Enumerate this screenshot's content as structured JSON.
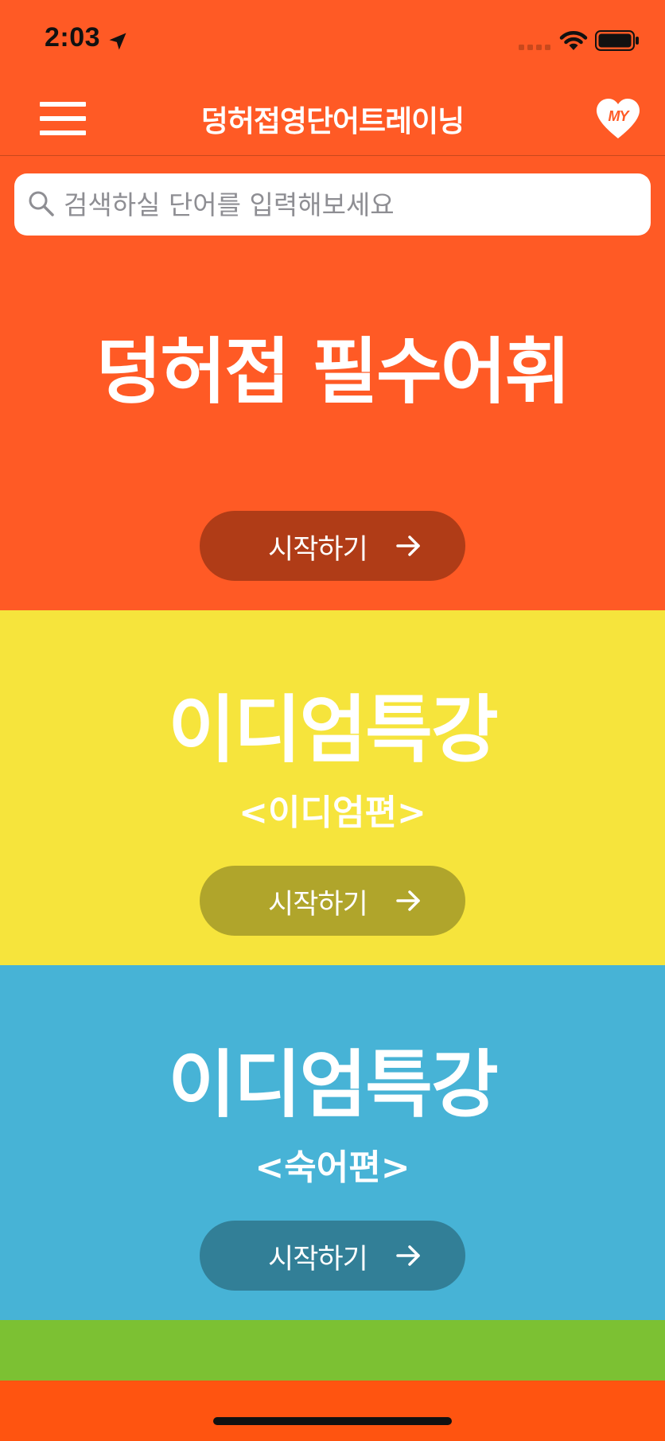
{
  "status_bar": {
    "time": "2:03"
  },
  "nav": {
    "title": "덩허접영단어트레이닝",
    "my_label": "MY"
  },
  "search": {
    "placeholder": "검색하실 단어를 입력해보세요",
    "value": ""
  },
  "cards": [
    {
      "title": "덩허접 필수어휘",
      "subtitle": "",
      "button_label": "시작하기",
      "background": "#FF5A25",
      "button_color": "#B03C17"
    },
    {
      "title": "이디엄특강",
      "subtitle": "<이디엄편>",
      "button_label": "시작하기",
      "background": "#F6E43C",
      "button_color": "#B0A52B"
    },
    {
      "title": "이디엄특강",
      "subtitle": "<숙어편>",
      "button_label": "시작하기",
      "background": "#47B3D6",
      "button_color": "#327F97"
    },
    {
      "title": "",
      "subtitle": "",
      "button_label": "",
      "background": "#7CC133"
    }
  ],
  "colors": {
    "primary": "#FF5A25",
    "bottom_bar": "#FF5410"
  },
  "icons": {
    "menu": "hamburger-menu-icon",
    "my": "heart-icon",
    "search": "magnifier-icon",
    "arrow": "arrow-right-icon"
  }
}
